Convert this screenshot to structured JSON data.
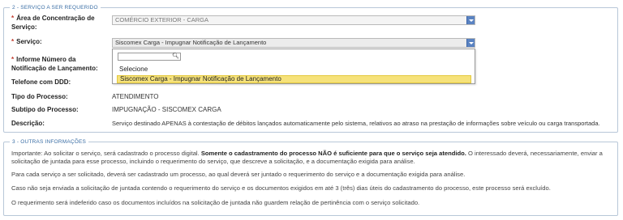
{
  "section1": {
    "legend": "2 - SERVIÇO A SER REQUERIDO",
    "area": {
      "label_line1": "Área de Concentração de",
      "label_line2": "Serviço:",
      "value": "COMÉRCIO EXTERIOR - CARGA"
    },
    "servico": {
      "label": "Serviço:",
      "value": "Siscomex Carga - Impugnar Notificação de Lançamento"
    },
    "dropdown": {
      "search_value": "",
      "options": [
        "Selecione",
        "Siscomex Carga - Impugnar Notificação de Lançamento"
      ]
    },
    "informe": {
      "label_line1": "Informe Número da",
      "label_line2": "Notificação de Lançamento:"
    },
    "telefone": {
      "label": "Telefone com DDD:"
    },
    "tipo": {
      "label": "Tipo do Processo:",
      "value": "ATENDIMENTO"
    },
    "subtipo": {
      "label": "Subtipo do Processo:",
      "value": "IMPUGNAÇÃO - SISCOMEX CARGA"
    },
    "descricao": {
      "label": "Descrição:",
      "value": "Serviço destinado APENAS à contestação de débitos lançados automaticamente pelo sistema, relativos ao atraso na prestação de informações sobre veículo ou carga transportada."
    }
  },
  "section2": {
    "legend": "3 - OUTRAS INFORMAÇÕES",
    "p1_start": "Importante: Ao solicitar o serviço, será cadastrado o processo digital. ",
    "p1_bold": "Somente o cadastramento do processo NÃO é suficiente para que o serviço seja atendido.",
    "p1_end": " O interessado deverá, necessariamente, enviar a solicitação de juntada para esse processo, incluindo o requerimento do serviço, que descreve a solicitação, e a documentação exigida para análise.",
    "p2": "Para cada serviço a ser solicitado, deverá ser cadastrado um processo, ao qual deverá ser juntado o requerimento do serviço e a documentação exigida para análise.",
    "p3": "Caso não seja enviada a solicitação de juntada contendo o requerimento do serviço e os documentos exigidos em até 3 (três) dias úteis do cadastramento do processo, este processo será excluído.",
    "p4": "O requerimento será indeferido caso os documentos incluídos na solicitação de juntada não guardem relação de pertinência com o serviço solicitado."
  },
  "required_marker": "*",
  "colors": {
    "legend": "#3a6ea5",
    "required": "#c0392b",
    "highlight": "#f6e27a",
    "select_arrow": "#5a83c2"
  },
  "icons": {
    "search": "magnifier-icon",
    "select_arrow": "chevron-down-icon"
  }
}
